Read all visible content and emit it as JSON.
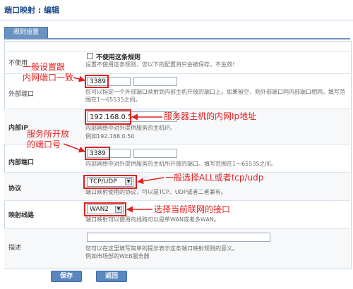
{
  "page": {
    "title": "端口映射 : 编辑",
    "tab_label": "规则设置"
  },
  "form": {
    "disable": {
      "label": "不使用",
      "checkbox_label": "不使用这条规则",
      "hint": "设置不使用这条规则，您以下的配置将只会被保存，不生效！"
    },
    "external_port": {
      "label": "外部端口",
      "value_start": "3389",
      "value_end": "",
      "hint": "您可以指定一个外部端口映射到内部主机开放的端口上。如果留空，则外部端口同内部端口相同。填写范围在1～65535之间。"
    },
    "internal_ip": {
      "label": "内部IP",
      "value": "192.168.0.5",
      "hint1": "内部网络中对外提供服务的主机IP。",
      "hint2": "例如192.168.0.50"
    },
    "internal_port": {
      "label": "内部端口",
      "value_start": "3389",
      "value_end": "",
      "hint": "内部网络中对外提供服务的主机所开放的端口。填写范围在1～65535之间。"
    },
    "protocol": {
      "label": "协议",
      "value": "TCP/UDP",
      "hint": "端口映射使用的协议，可以是TCP、UDP或者二者兼有。"
    },
    "line": {
      "label": "映射线路",
      "value": "WAN2",
      "hint": "端口映射可以使用的线路可以是单WAN或者多WAN。"
    },
    "desc": {
      "label": "描述",
      "value": "",
      "hint1": "您可以在这里填写简单的提示表示这条端口映射规则的意义。",
      "hint2": "例如市场部的WEB服务器"
    }
  },
  "buttons": {
    "save": "保存",
    "back": "返回"
  },
  "annotations": {
    "a1_line1": "一般设置跟",
    "a1_line2": "内网端口一致",
    "a2": "服务器主机的内网Ip地址",
    "a3_line1": "服务所开放",
    "a3_line2": "的端口号",
    "a4": "一般选择ALL或者tcp/udp",
    "a5": "选择当前联网的接口"
  },
  "colors": {
    "annotation": "#e02020",
    "accent": "#6b93c2",
    "title": "#1e4a8a"
  }
}
